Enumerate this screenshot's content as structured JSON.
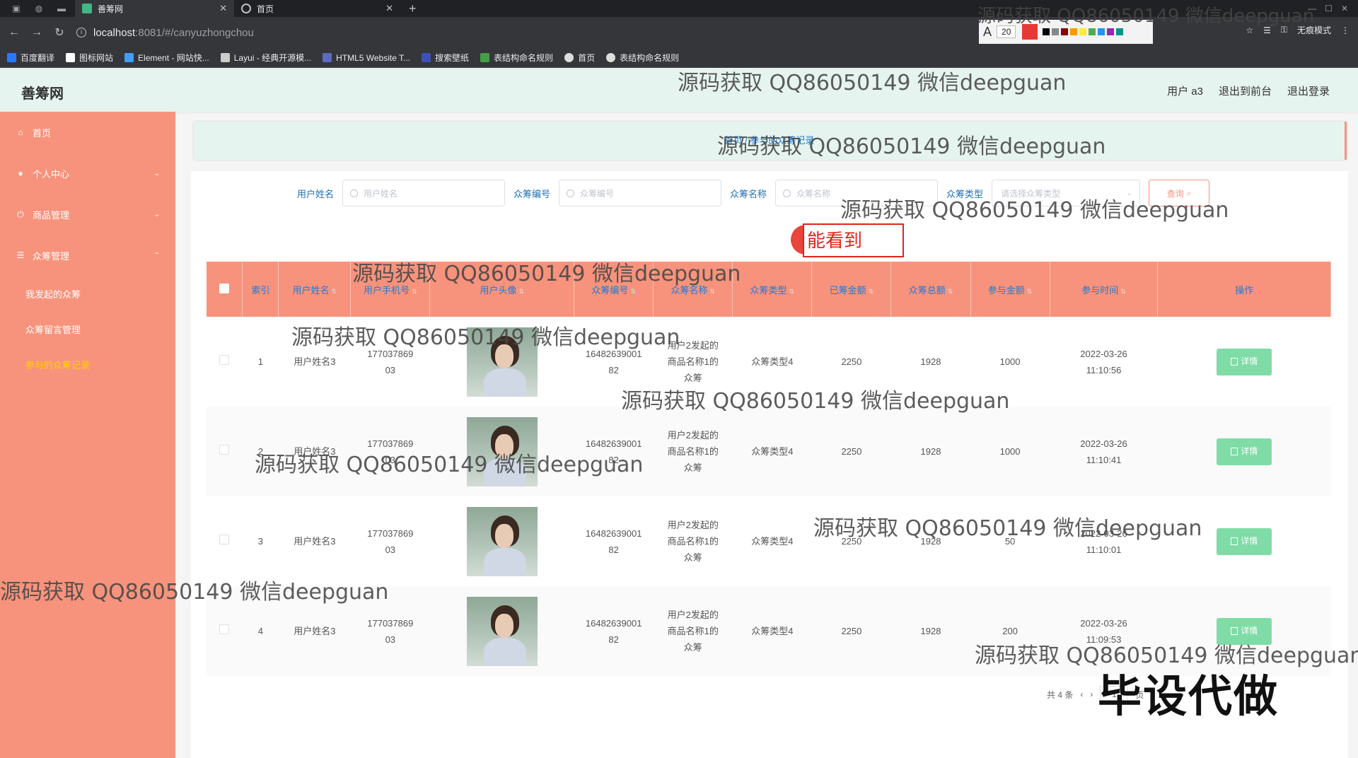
{
  "browser": {
    "tabs": [
      {
        "title": "善筹网",
        "active": true
      },
      {
        "title": "首页",
        "active": false
      }
    ],
    "url_host": "localhost",
    "url_rest": ":8081/#/canyuzhongchou",
    "font_size_value": "20",
    "incognito_label": "无痕模式",
    "bookmarks": [
      "百度翻译",
      "图标网站",
      "Element - 网站快...",
      "Layui - 经典开源模...",
      "HTML5 Website T...",
      "搜索壁纸",
      "表结构命名规则",
      "首页",
      "表结构命名规则"
    ]
  },
  "header": {
    "brand": "善筹网",
    "links": [
      "用户 a3",
      "退出到前台",
      "退出登录"
    ]
  },
  "sidebar": {
    "items": [
      {
        "label": "首页",
        "icon": "home-icon"
      },
      {
        "label": "个人中心",
        "icon": "user-icon"
      },
      {
        "label": "商品管理",
        "icon": "power-icon"
      },
      {
        "label": "众筹管理",
        "icon": "list-icon"
      }
    ],
    "subitems": [
      "我发起的众筹",
      "众筹留言管理",
      "参与的众筹记录"
    ]
  },
  "breadcrumb": "首页 / 参与的众筹记录",
  "filters": {
    "labels": [
      "用户姓名",
      "众筹编号",
      "众筹名称",
      "众筹类型"
    ],
    "placeholders": [
      "用户姓名",
      "众筹编号",
      "众筹名称"
    ],
    "select_placeholder": "请选择众筹类型",
    "query_button": "查询"
  },
  "table": {
    "columns": [
      "索引",
      "用户姓名",
      "用户手机号",
      "用户头像",
      "众筹编号",
      "众筹名称",
      "众筹类型",
      "已筹金额",
      "众筹总额",
      "参与金额",
      "参与时间",
      "操作"
    ],
    "detail_label": "详情",
    "rows": [
      {
        "index": "1",
        "name": "用户姓名3",
        "phone": "17703786903",
        "code": "1648263900182",
        "title": "用户2发起的商品名称1的众筹",
        "type": "众筹类型4",
        "raised": "2250",
        "total": "1928",
        "amount": "1000",
        "date": "2022-03-26",
        "time": "11:10:56"
      },
      {
        "index": "2",
        "name": "用户姓名3",
        "phone": "17703786903",
        "code": "1648263900182",
        "title": "用户2发起的商品名称1的众筹",
        "type": "众筹类型4",
        "raised": "2250",
        "total": "1928",
        "amount": "1000",
        "date": "2022-03-26",
        "time": "11:10:41"
      },
      {
        "index": "3",
        "name": "用户姓名3",
        "phone": "17703786903",
        "code": "1648263900182",
        "title": "用户2发起的商品名称1的众筹",
        "type": "众筹类型4",
        "raised": "2250",
        "total": "1928",
        "amount": "50",
        "date": "2022-03-26",
        "time": "11:10:01"
      },
      {
        "index": "4",
        "name": "用户姓名3",
        "phone": "17703786903",
        "code": "1648263900182",
        "title": "用户2发起的商品名称1的众筹",
        "type": "众筹类型4",
        "raised": "2250",
        "total": "1928",
        "amount": "200",
        "date": "2022-03-26",
        "time": "11:09:53"
      }
    ]
  },
  "pagination": {
    "total_text": "共 4 条",
    "page": "1",
    "page_suffix": "页"
  },
  "overlays": {
    "watermark": "源码获取 QQ86050149 微信deepguan",
    "callout": "能看到",
    "stamp": "毕设代做"
  },
  "colors": {
    "sidebar": "#f7937c",
    "header": "#e6f4ef",
    "accent_text": "#1e7ad6",
    "detail_button": "#7fdca6",
    "active_submenu": "#ffd100"
  }
}
